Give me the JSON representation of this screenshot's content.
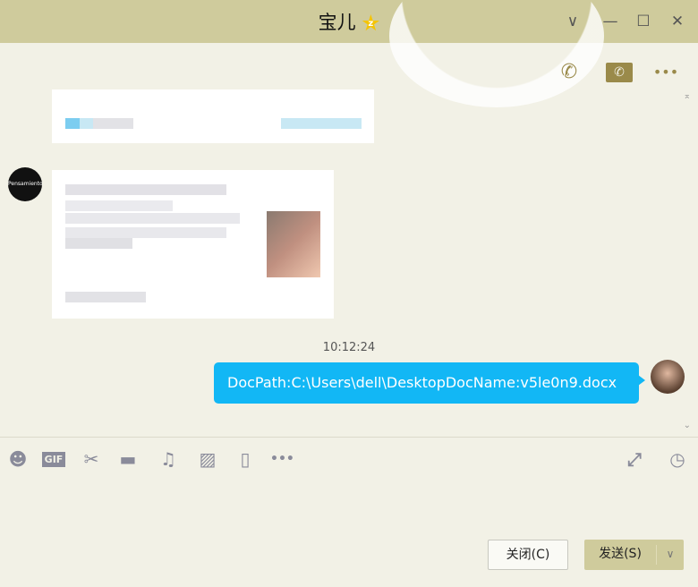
{
  "window": {
    "title": "宝儿",
    "status_badge": "z",
    "minimize": "—",
    "maximize": "☐",
    "close": "✕",
    "menu": "∨"
  },
  "header_actions": {
    "more": "•••"
  },
  "chat": {
    "timestamp": "10:12:24",
    "sent_message": "DocPath:C:\\Users\\dell\\DesktopDocName:v5le0n9.docx",
    "contact_avatar_text": "Pensamiento"
  },
  "toolbar": {
    "gif": "GIF",
    "more": "•••"
  },
  "buttons": {
    "close": "关闭(C)",
    "send": "发送(S)",
    "send_dropdown": "∨"
  },
  "colors": {
    "titlebar": "#cfcb9c",
    "background": "#f2f1e6",
    "bubble": "#12b7f5",
    "icon": "#8a8b9a",
    "accent": "#9a8a4a"
  }
}
